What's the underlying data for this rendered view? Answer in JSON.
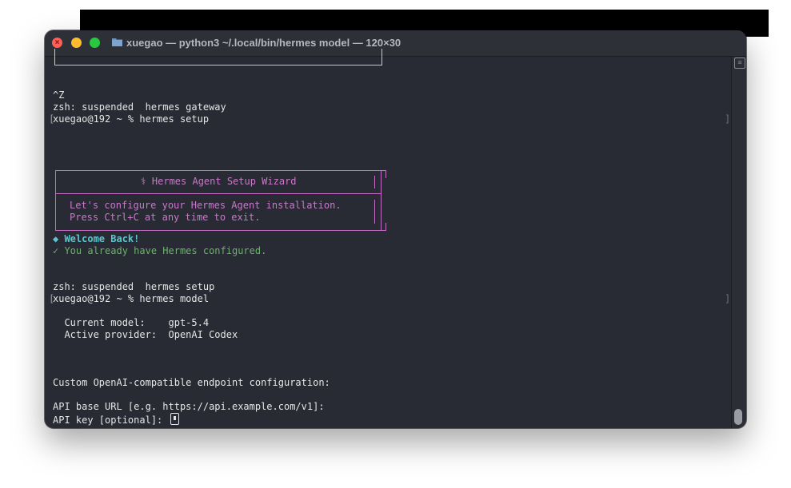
{
  "window": {
    "title": "xuegao — python3 ~/.local/bin/hermes model — 120×30"
  },
  "terminal": {
    "lines": [
      "^Z",
      "zsh: suspended  hermes gateway",
      "xuegao@192 ~ % hermes setup"
    ],
    "wizard": {
      "title": "⚕ Hermes Agent Setup Wizard",
      "line1": "Let's configure your Hermes Agent installation.",
      "line2": "Press Ctrl+C at any time to exit."
    },
    "welcome": "◆ Welcome Back!",
    "configured": "✓ You already have Hermes configured.",
    "suspended_setup": "zsh: suspended  hermes setup",
    "prompt_model": "xuegao@192 ~ % hermes model",
    "current_model": "  Current model:    gpt-5.4",
    "active_provider": "  Active provider:  OpenAI Codex",
    "custom_endpoint": "Custom OpenAI-compatible endpoint configuration:",
    "api_base": "API base URL [e.g. https://api.example.com/v1]:",
    "api_key": "API key [optional]: "
  },
  "colors": {
    "background": "#282b33",
    "purple": "#c979c9",
    "cyan": "#5cc6d0",
    "green": "#6ab36a"
  }
}
